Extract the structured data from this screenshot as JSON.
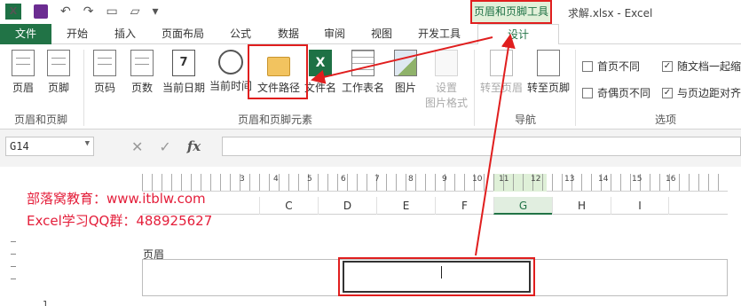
{
  "titlebar": {
    "app_logo": "X",
    "context_tab_title": "页眉和页脚工具",
    "window_title": "求解.xlsx - Excel",
    "qat_icons": [
      "excel-logo",
      "save-icon",
      "undo-icon",
      "redo-icon",
      "print-preview-icon",
      "open-folder-icon",
      "customize-icon"
    ]
  },
  "tabs": [
    "文件",
    "开始",
    "插入",
    "页面布局",
    "公式",
    "数据",
    "审阅",
    "视图",
    "开发工具",
    "设计"
  ],
  "ribbon": {
    "groups": {
      "header_footer": {
        "label": "页眉和页脚",
        "buttons": [
          "页眉",
          "页脚"
        ]
      },
      "elements": {
        "label": "页眉和页脚元素",
        "buttons": [
          "页码",
          "页数",
          "当前日期",
          "当前时间",
          "文件路径",
          "文件名",
          "工作表名",
          "图片"
        ],
        "format_picture_line1": "设置",
        "format_picture_line2": "图片格式"
      },
      "navigation": {
        "label": "导航",
        "buttons": [
          "转至页眉",
          "转至页脚"
        ]
      },
      "options": {
        "label": "选项",
        "checkboxes": [
          {
            "label": "首页不同",
            "checked": false
          },
          {
            "label": "随文档一起缩",
            "checked": true
          },
          {
            "label": "奇偶页不同",
            "checked": false
          },
          {
            "label": "与页边距对齐",
            "checked": true
          }
        ]
      }
    }
  },
  "formula_bar": {
    "name_box": "G14",
    "cancel": "✕",
    "enter": "✓",
    "fx": "fx",
    "content": ""
  },
  "sheet": {
    "ruler_numbers": [
      "3",
      "4",
      "5",
      "6",
      "7",
      "8",
      "9",
      "10",
      "11",
      "12",
      "13",
      "14",
      "15",
      "16"
    ],
    "columns": [
      "C",
      "D",
      "E",
      "F",
      "G",
      "H",
      "I"
    ],
    "selected_column": "G",
    "page_header_label": "页眉",
    "row_number": "1"
  },
  "watermark": {
    "line1": "部落窝教育：www.itblw.com",
    "line2": "Excel学习QQ群：488925627"
  },
  "colors": {
    "accent": "#217346",
    "highlight": "#e01e1e"
  }
}
